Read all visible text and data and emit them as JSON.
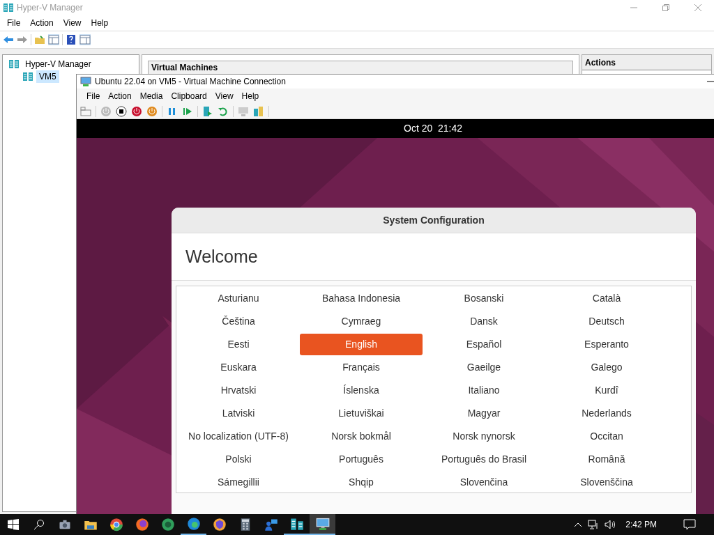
{
  "manager": {
    "title": "Hyper-V Manager",
    "menu": [
      "File",
      "Action",
      "View",
      "Help"
    ],
    "tree": [
      {
        "label": "Hyper-V Manager",
        "selected": false,
        "children": [
          {
            "label": "VM5",
            "selected": true
          }
        ]
      }
    ],
    "center_header": "Virtual Machines",
    "actions_header": "Actions"
  },
  "vm_window": {
    "title": "Ubuntu 22.04 on VM5 - Virtual Machine Connection",
    "menu": [
      "File",
      "Action",
      "Media",
      "Clipboard",
      "View",
      "Help"
    ]
  },
  "guest": {
    "clock": "Oct 20  21:42",
    "dialog_title": "System Configuration",
    "heading": "Welcome",
    "languages": [
      {
        "label": "Asturianu",
        "selected": false
      },
      {
        "label": "Bahasa Indonesia",
        "selected": false
      },
      {
        "label": "Bosanski",
        "selected": false
      },
      {
        "label": "Català",
        "selected": false
      },
      {
        "label": "Čeština",
        "selected": false
      },
      {
        "label": "Cymraeg",
        "selected": false
      },
      {
        "label": "Dansk",
        "selected": false
      },
      {
        "label": "Deutsch",
        "selected": false
      },
      {
        "label": "Eesti",
        "selected": false
      },
      {
        "label": "English",
        "selected": true
      },
      {
        "label": "Español",
        "selected": false
      },
      {
        "label": "Esperanto",
        "selected": false
      },
      {
        "label": "Euskara",
        "selected": false
      },
      {
        "label": "Français",
        "selected": false
      },
      {
        "label": "Gaeilge",
        "selected": false
      },
      {
        "label": "Galego",
        "selected": false
      },
      {
        "label": "Hrvatski",
        "selected": false
      },
      {
        "label": "Íslenska",
        "selected": false
      },
      {
        "label": "Italiano",
        "selected": false
      },
      {
        "label": "Kurdî",
        "selected": false
      },
      {
        "label": "Latviski",
        "selected": false
      },
      {
        "label": "Lietuviškai",
        "selected": false
      },
      {
        "label": "Magyar",
        "selected": false
      },
      {
        "label": "Nederlands",
        "selected": false
      },
      {
        "label": "No localization (UTF-8)",
        "selected": false
      },
      {
        "label": "Norsk bokmål",
        "selected": false
      },
      {
        "label": "Norsk nynorsk",
        "selected": false
      },
      {
        "label": "Occitan",
        "selected": false
      },
      {
        "label": "Polski",
        "selected": false
      },
      {
        "label": "Português",
        "selected": false
      },
      {
        "label": "Português do Brasil",
        "selected": false
      },
      {
        "label": "Română",
        "selected": false
      },
      {
        "label": "Sámegillii",
        "selected": false
      },
      {
        "label": "Shqip",
        "selected": false
      },
      {
        "label": "Slovenčina",
        "selected": false
      },
      {
        "label": "Slovenščina",
        "selected": false
      }
    ]
  },
  "taskbar": {
    "apps": [
      {
        "kind": "camera",
        "open": false
      },
      {
        "kind": "folder",
        "open": false
      },
      {
        "kind": "browser-red",
        "open": false
      },
      {
        "kind": "browser-orange",
        "open": false
      },
      {
        "kind": "browser-green",
        "open": false
      },
      {
        "kind": "browser-blue",
        "open": true
      },
      {
        "kind": "browser-shield",
        "open": false
      },
      {
        "kind": "calculator",
        "open": false
      },
      {
        "kind": "people",
        "open": false
      },
      {
        "kind": "servers",
        "open": true
      },
      {
        "kind": "vm",
        "open": true
      }
    ],
    "clock": "2:42 PM"
  }
}
